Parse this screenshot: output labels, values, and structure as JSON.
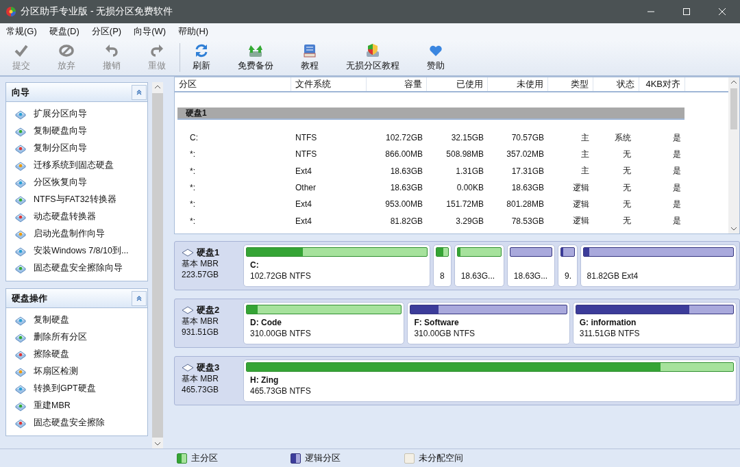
{
  "window": {
    "title": "分区助手专业版 - 无损分区免费软件"
  },
  "menu": [
    {
      "label": "常规(G)"
    },
    {
      "label": "硬盘(D)"
    },
    {
      "label": "分区(P)"
    },
    {
      "label": "向导(W)"
    },
    {
      "label": "帮助(H)"
    }
  ],
  "toolbar": [
    {
      "label": "提交",
      "disabled": true
    },
    {
      "label": "放弃",
      "disabled": true
    },
    {
      "label": "撤销",
      "disabled": true
    },
    {
      "label": "重做",
      "disabled": true
    },
    {
      "label": "刷新",
      "disabled": false
    },
    {
      "label": "免费备份",
      "disabled": false
    },
    {
      "label": "教程",
      "disabled": false
    },
    {
      "label": "无损分区教程",
      "disabled": false
    },
    {
      "label": "赞助",
      "disabled": false
    }
  ],
  "sidebar": {
    "panels": [
      {
        "title": "向导",
        "expanded": true,
        "items": [
          "扩展分区向导",
          "复制硬盘向导",
          "复制分区向导",
          "迁移系统到固态硬盘",
          "分区恢复向导",
          "NTFS与FAT32转换器",
          "动态硬盘转换器",
          "启动光盘制作向导",
          "安装Windows 7/8/10到...",
          "固态硬盘安全擦除向导"
        ]
      },
      {
        "title": "硬盘操作",
        "expanded": true,
        "items": [
          "复制硬盘",
          "删除所有分区",
          "擦除硬盘",
          "坏扇区检测",
          "转换到GPT硬盘",
          "重建MBR",
          "固态硬盘安全擦除"
        ]
      }
    ]
  },
  "table": {
    "columns": [
      "分区",
      "文件系统",
      "容量",
      "已使用",
      "未使用",
      "类型",
      "状态",
      "4KB对齐"
    ],
    "groups": [
      {
        "label": "硬盘1",
        "rows": [
          [
            "C:",
            "NTFS",
            "102.72GB",
            "32.15GB",
            "70.57GB",
            "主",
            "系统",
            "是"
          ],
          [
            "*:",
            "NTFS",
            "866.00MB",
            "508.98MB",
            "357.02MB",
            "主",
            "无",
            "是"
          ],
          [
            "*:",
            "Ext4",
            "18.63GB",
            "1.31GB",
            "17.31GB",
            "主",
            "无",
            "是"
          ],
          [
            "*:",
            "Other",
            "18.63GB",
            "0.00KB",
            "18.63GB",
            "逻辑",
            "无",
            "是"
          ],
          [
            "*:",
            "Ext4",
            "953.00MB",
            "151.72MB",
            "801.28MB",
            "逻辑",
            "无",
            "是"
          ],
          [
            "*:",
            "Ext4",
            "81.82GB",
            "3.29GB",
            "78.53GB",
            "逻辑",
            "无",
            "是"
          ]
        ]
      }
    ]
  },
  "disks": [
    {
      "name": "硬盘1",
      "type": "基本 MBR",
      "size": "223.57GB",
      "partitions": [
        {
          "kind": "primary",
          "level": 0.31,
          "name": "C:",
          "detail": "102.72GB NTFS"
        },
        {
          "kind": "primary",
          "level": 0.6,
          "detail": "8"
        },
        {
          "kind": "primary",
          "level": 0.07,
          "detail": "18.63G..."
        },
        {
          "kind": "logical",
          "detail": "18.63G..."
        },
        {
          "kind": "logical",
          "level": 0.16,
          "detail": "9."
        },
        {
          "kind": "logical",
          "level": 0.04,
          "detail": "81.82GB Ext4"
        }
      ]
    },
    {
      "name": "硬盘2",
      "type": "基本 MBR",
      "size": "931.51GB",
      "partitions": [
        {
          "kind": "primary",
          "level": 0.07,
          "name": "D: Code",
          "detail": "310.00GB NTFS"
        },
        {
          "kind": "logical",
          "level": 0.18,
          "name": "F: Software",
          "detail": "310.00GB NTFS"
        },
        {
          "kind": "logical",
          "level": 0.72,
          "name": "G: information",
          "detail": "311.51GB NTFS"
        }
      ]
    },
    {
      "name": "硬盘3",
      "type": "基本 MBR",
      "size": "465.73GB",
      "partitions": [
        {
          "kind": "primary",
          "level": 0.85,
          "name": "H: Zing",
          "detail": "465.73GB NTFS"
        }
      ]
    }
  ],
  "legend": [
    {
      "kind": "primary",
      "label": "主分区"
    },
    {
      "kind": "logical",
      "label": "逻辑分区"
    },
    {
      "kind": "unallocated",
      "label": "未分配空间"
    }
  ]
}
